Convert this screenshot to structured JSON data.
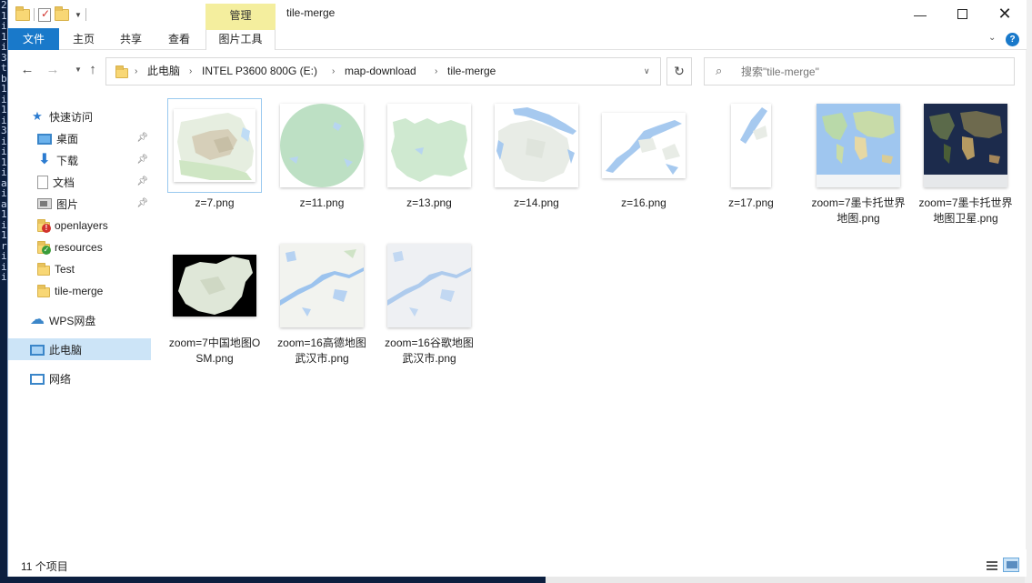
{
  "window": {
    "title": "tile-merge",
    "context_group": "管理",
    "minimize_icon": "minimize-icon",
    "maximize_icon": "maximize-icon",
    "close_icon": "close-icon"
  },
  "ribbon": {
    "tabs": [
      {
        "label": "文件"
      },
      {
        "label": "主页"
      },
      {
        "label": "共享"
      },
      {
        "label": "查看"
      },
      {
        "label": "图片工具"
      }
    ],
    "active_color": "#1979ca",
    "context_color": "#f4ee9e",
    "help_label": "?"
  },
  "address": {
    "crumbs": [
      "此电脑",
      "INTEL P3600 800G (E:)",
      "map-download",
      "tile-merge"
    ]
  },
  "search": {
    "placeholder": "搜索\"tile-merge\""
  },
  "nav": {
    "quick_access": "快速访问",
    "items": [
      {
        "label": "桌面",
        "icon": "desktop-icon"
      },
      {
        "label": "下载",
        "icon": "download-icon"
      },
      {
        "label": "文档",
        "icon": "document-icon"
      },
      {
        "label": "图片",
        "icon": "pictures-icon"
      },
      {
        "label": "openlayers",
        "icon": "folder-icon"
      },
      {
        "label": "resources",
        "icon": "folder-icon"
      },
      {
        "label": "Test",
        "icon": "folder-icon"
      },
      {
        "label": "tile-merge",
        "icon": "folder-icon"
      }
    ],
    "wps": "WPS网盘",
    "this_pc": "此电脑",
    "network": "网络",
    "selected_bg": "#cce4f7"
  },
  "files": [
    {
      "name": "z=7.png"
    },
    {
      "name": "z=11.png"
    },
    {
      "name": "z=13.png"
    },
    {
      "name": "z=14.png"
    },
    {
      "name": "z=16.png"
    },
    {
      "name": "z=17.png"
    },
    {
      "name": "zoom=7墨卡托世界地图.png"
    },
    {
      "name": "zoom=7墨卡托世界地图卫星.png"
    },
    {
      "name": "zoom=7中国地图OSM.png"
    },
    {
      "name": "zoom=16高德地图武汉市.png"
    },
    {
      "name": "zoom=16谷歌地图武汉市.png"
    }
  ],
  "status": {
    "count": "11 个项目"
  },
  "background_text": [
    "2",
    "1",
    "i",
    "1",
    "i",
    "3",
    "t",
    "b",
    "1",
    "i",
    "1",
    "i",
    "3",
    "i",
    "i",
    "1",
    "i",
    "a",
    "i",
    "a",
    "1",
    "i",
    "1",
    "r",
    "i",
    "i",
    "i"
  ]
}
